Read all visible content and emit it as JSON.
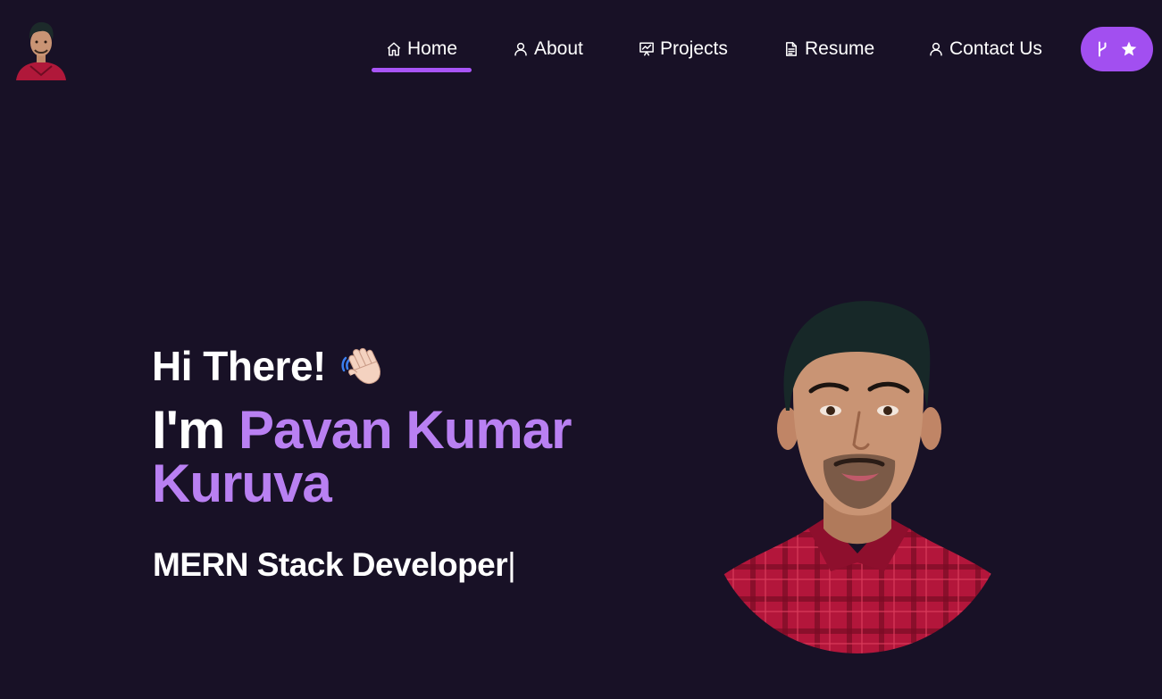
{
  "nav": {
    "items": [
      {
        "label": "Home",
        "icon": "home-icon",
        "active": true
      },
      {
        "label": "About",
        "icon": "user-icon"
      },
      {
        "label": "Projects",
        "icon": "presentation-icon"
      },
      {
        "label": "Resume",
        "icon": "document-icon"
      },
      {
        "label": "Contact Us",
        "icon": "user-icon"
      }
    ],
    "fork_button": {
      "icons": [
        "git-fork-icon",
        "star-icon"
      ]
    }
  },
  "hero": {
    "greeting": "Hi There!",
    "greeting_emoji": "waving-hand-icon",
    "intro_prefix": "I'm ",
    "name": "Pavan Kumar Kuruva",
    "typewriter_text": "MERN Stack Developer",
    "cursor": "|"
  },
  "colors": {
    "background": "#181126",
    "accent": "#a855f7",
    "name_color": "#b980f2",
    "button_bg": "#a24ff0"
  }
}
